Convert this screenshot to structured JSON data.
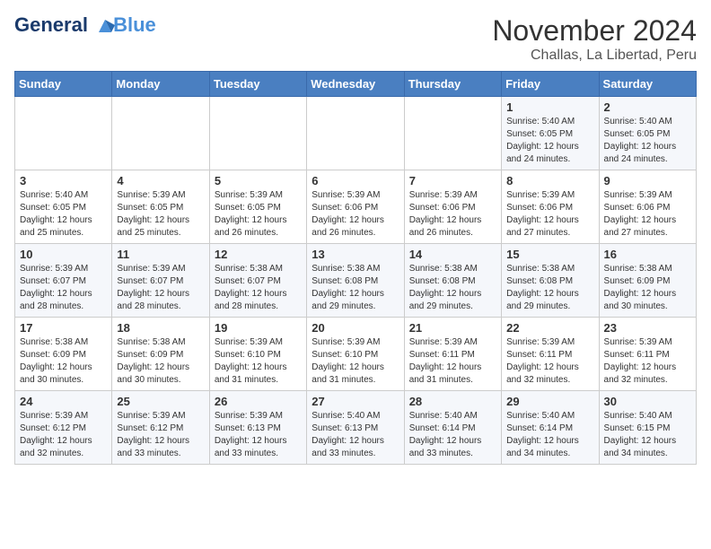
{
  "header": {
    "logo_line1": "General",
    "logo_line2": "Blue",
    "month": "November 2024",
    "location": "Challas, La Libertad, Peru"
  },
  "weekdays": [
    "Sunday",
    "Monday",
    "Tuesday",
    "Wednesday",
    "Thursday",
    "Friday",
    "Saturday"
  ],
  "rows": [
    [
      {
        "day": "",
        "info": ""
      },
      {
        "day": "",
        "info": ""
      },
      {
        "day": "",
        "info": ""
      },
      {
        "day": "",
        "info": ""
      },
      {
        "day": "",
        "info": ""
      },
      {
        "day": "1",
        "info": "Sunrise: 5:40 AM\nSunset: 6:05 PM\nDaylight: 12 hours and 24 minutes."
      },
      {
        "day": "2",
        "info": "Sunrise: 5:40 AM\nSunset: 6:05 PM\nDaylight: 12 hours and 24 minutes."
      }
    ],
    [
      {
        "day": "3",
        "info": "Sunrise: 5:40 AM\nSunset: 6:05 PM\nDaylight: 12 hours and 25 minutes."
      },
      {
        "day": "4",
        "info": "Sunrise: 5:39 AM\nSunset: 6:05 PM\nDaylight: 12 hours and 25 minutes."
      },
      {
        "day": "5",
        "info": "Sunrise: 5:39 AM\nSunset: 6:05 PM\nDaylight: 12 hours and 26 minutes."
      },
      {
        "day": "6",
        "info": "Sunrise: 5:39 AM\nSunset: 6:06 PM\nDaylight: 12 hours and 26 minutes."
      },
      {
        "day": "7",
        "info": "Sunrise: 5:39 AM\nSunset: 6:06 PM\nDaylight: 12 hours and 26 minutes."
      },
      {
        "day": "8",
        "info": "Sunrise: 5:39 AM\nSunset: 6:06 PM\nDaylight: 12 hours and 27 minutes."
      },
      {
        "day": "9",
        "info": "Sunrise: 5:39 AM\nSunset: 6:06 PM\nDaylight: 12 hours and 27 minutes."
      }
    ],
    [
      {
        "day": "10",
        "info": "Sunrise: 5:39 AM\nSunset: 6:07 PM\nDaylight: 12 hours and 28 minutes."
      },
      {
        "day": "11",
        "info": "Sunrise: 5:39 AM\nSunset: 6:07 PM\nDaylight: 12 hours and 28 minutes."
      },
      {
        "day": "12",
        "info": "Sunrise: 5:38 AM\nSunset: 6:07 PM\nDaylight: 12 hours and 28 minutes."
      },
      {
        "day": "13",
        "info": "Sunrise: 5:38 AM\nSunset: 6:08 PM\nDaylight: 12 hours and 29 minutes."
      },
      {
        "day": "14",
        "info": "Sunrise: 5:38 AM\nSunset: 6:08 PM\nDaylight: 12 hours and 29 minutes."
      },
      {
        "day": "15",
        "info": "Sunrise: 5:38 AM\nSunset: 6:08 PM\nDaylight: 12 hours and 29 minutes."
      },
      {
        "day": "16",
        "info": "Sunrise: 5:38 AM\nSunset: 6:09 PM\nDaylight: 12 hours and 30 minutes."
      }
    ],
    [
      {
        "day": "17",
        "info": "Sunrise: 5:38 AM\nSunset: 6:09 PM\nDaylight: 12 hours and 30 minutes."
      },
      {
        "day": "18",
        "info": "Sunrise: 5:38 AM\nSunset: 6:09 PM\nDaylight: 12 hours and 30 minutes."
      },
      {
        "day": "19",
        "info": "Sunrise: 5:39 AM\nSunset: 6:10 PM\nDaylight: 12 hours and 31 minutes."
      },
      {
        "day": "20",
        "info": "Sunrise: 5:39 AM\nSunset: 6:10 PM\nDaylight: 12 hours and 31 minutes."
      },
      {
        "day": "21",
        "info": "Sunrise: 5:39 AM\nSunset: 6:11 PM\nDaylight: 12 hours and 31 minutes."
      },
      {
        "day": "22",
        "info": "Sunrise: 5:39 AM\nSunset: 6:11 PM\nDaylight: 12 hours and 32 minutes."
      },
      {
        "day": "23",
        "info": "Sunrise: 5:39 AM\nSunset: 6:11 PM\nDaylight: 12 hours and 32 minutes."
      }
    ],
    [
      {
        "day": "24",
        "info": "Sunrise: 5:39 AM\nSunset: 6:12 PM\nDaylight: 12 hours and 32 minutes."
      },
      {
        "day": "25",
        "info": "Sunrise: 5:39 AM\nSunset: 6:12 PM\nDaylight: 12 hours and 33 minutes."
      },
      {
        "day": "26",
        "info": "Sunrise: 5:39 AM\nSunset: 6:13 PM\nDaylight: 12 hours and 33 minutes."
      },
      {
        "day": "27",
        "info": "Sunrise: 5:40 AM\nSunset: 6:13 PM\nDaylight: 12 hours and 33 minutes."
      },
      {
        "day": "28",
        "info": "Sunrise: 5:40 AM\nSunset: 6:14 PM\nDaylight: 12 hours and 33 minutes."
      },
      {
        "day": "29",
        "info": "Sunrise: 5:40 AM\nSunset: 6:14 PM\nDaylight: 12 hours and 34 minutes."
      },
      {
        "day": "30",
        "info": "Sunrise: 5:40 AM\nSunset: 6:15 PM\nDaylight: 12 hours and 34 minutes."
      }
    ]
  ]
}
